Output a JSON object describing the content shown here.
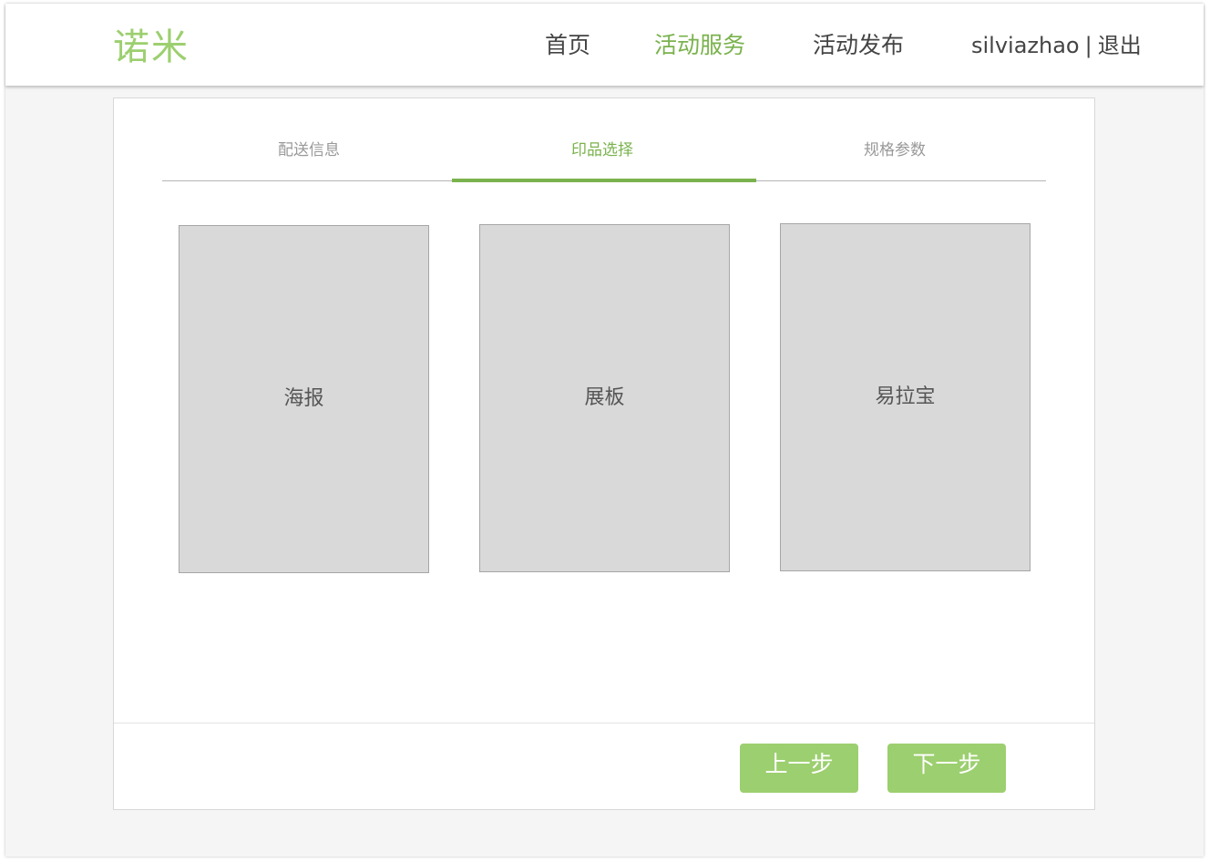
{
  "header": {
    "logo": "诺米",
    "nav": [
      "首页",
      "活动服务",
      "活动发布"
    ],
    "active_nav": "活动服务",
    "username": "silviazhao",
    "separator": "|",
    "logout_label": "退出"
  },
  "steps": {
    "tabs": [
      "配送信息",
      "印品选择",
      "规格参数"
    ],
    "active_tab": "印品选择"
  },
  "products": [
    "海报",
    "展板",
    "易拉宝"
  ],
  "actions": {
    "prev_label": "上一步",
    "next_label": "下一步"
  },
  "colors": {
    "accent": "#7ab24d",
    "accent_light": "#9ccf6f",
    "card_placeholder": "#d9d9d9"
  }
}
